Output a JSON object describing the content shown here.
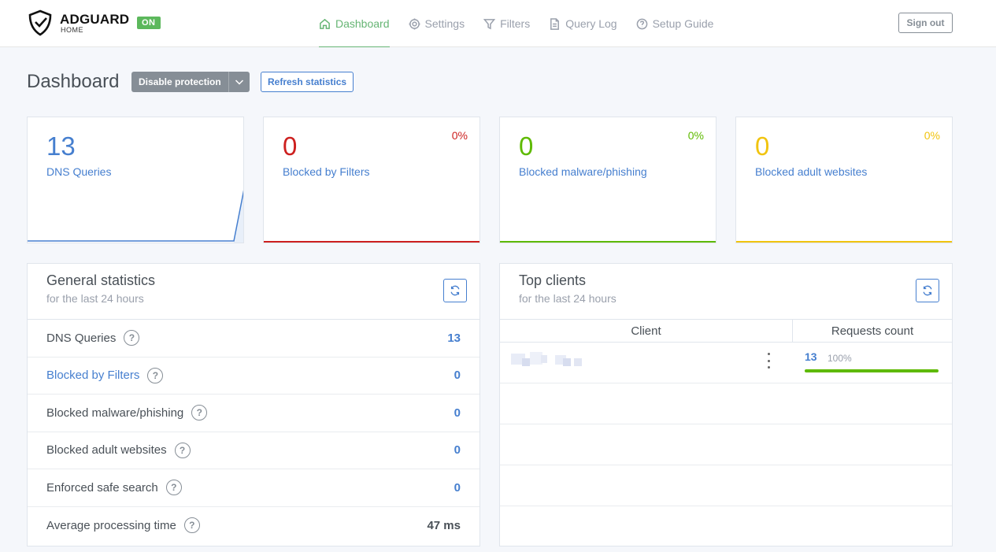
{
  "brand": {
    "name": "ADGUARD",
    "sub": "HOME",
    "status": "ON"
  },
  "nav": [
    {
      "label": "Dashboard",
      "icon": "home-icon",
      "active": true
    },
    {
      "label": "Settings",
      "icon": "gear-icon"
    },
    {
      "label": "Filters",
      "icon": "filter-icon"
    },
    {
      "label": "Query Log",
      "icon": "file-icon"
    },
    {
      "label": "Setup Guide",
      "icon": "help-circle-icon"
    }
  ],
  "signout": "Sign out",
  "page": {
    "title": "Dashboard",
    "disable_label": "Disable protection",
    "refresh_label": "Refresh statistics"
  },
  "cards": {
    "queries": {
      "value": "13",
      "label": "DNS Queries",
      "color": "#467fcf"
    },
    "filters": {
      "value": "0",
      "label": "Blocked by Filters",
      "pct": "0%",
      "color": "#cd201f"
    },
    "malware": {
      "value": "0",
      "label": "Blocked malware/phishing",
      "pct": "0%",
      "color": "#5eba00"
    },
    "adult": {
      "value": "0",
      "label": "Blocked adult websites",
      "pct": "0%",
      "color": "#f1c40f"
    }
  },
  "general": {
    "title": "General statistics",
    "subtitle": "for the last 24 hours",
    "rows": [
      {
        "label": "DNS Queries",
        "value": "13"
      },
      {
        "label": "Blocked by Filters",
        "value": "0"
      },
      {
        "label": "Blocked malware/phishing",
        "value": "0"
      },
      {
        "label": "Blocked adult websites",
        "value": "0"
      },
      {
        "label": "Enforced safe search",
        "value": "0"
      },
      {
        "label": "Average processing time",
        "value": "47 ms"
      }
    ]
  },
  "clients": {
    "title": "Top clients",
    "subtitle": "for the last 24 hours",
    "col_client": "Client",
    "col_count": "Requests count",
    "rows": [
      {
        "count": "13",
        "pct": "100%",
        "share": 1.0
      }
    ]
  },
  "help_glyph": "?"
}
